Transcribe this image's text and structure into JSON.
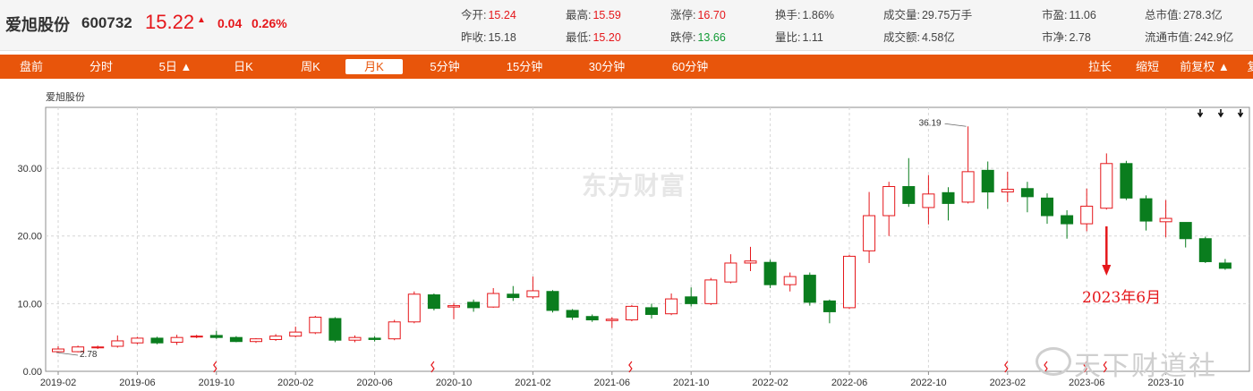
{
  "quote": {
    "name": "爱旭股份",
    "code": "600732",
    "price": "15.22",
    "arrow": "▲",
    "change": "0.04",
    "change_pct": "0.26%",
    "stats": [
      {
        "label": "今开:",
        "value": "15.24",
        "color": "red"
      },
      {
        "label": "昨收:",
        "value": "15.18",
        "color": "dark"
      },
      {
        "label": "最高:",
        "value": "15.59",
        "color": "red"
      },
      {
        "label": "最低:",
        "value": "15.20",
        "color": "red"
      },
      {
        "label": "涨停:",
        "value": "16.70",
        "color": "red"
      },
      {
        "label": "跌停:",
        "value": "13.66",
        "color": "green"
      },
      {
        "label": "换手:",
        "value": "1.86%",
        "color": "dark"
      },
      {
        "label": "量比:",
        "value": "1.11",
        "color": "dark"
      },
      {
        "label": "成交量:",
        "value": "29.75万手",
        "color": "dark"
      },
      {
        "label": "成交额:",
        "value": "4.58亿",
        "color": "dark"
      },
      {
        "label": "市盈:",
        "value": "11.06",
        "color": "dark"
      },
      {
        "label": "市净:",
        "value": "2.78",
        "color": "dark"
      },
      {
        "label": "总市值:",
        "value": "278.3亿",
        "color": "dark"
      },
      {
        "label": "流通市值:",
        "value": "242.9亿",
        "color": "dark"
      }
    ]
  },
  "tabs": {
    "left": [
      "盘前",
      "分时",
      "5日 ▲",
      "日K",
      "周K",
      "月K",
      "5分钟",
      "15分钟",
      "30分钟",
      "60分钟"
    ],
    "right": [
      "拉长",
      "缩短",
      "前复权 ▲",
      "复"
    ],
    "active": "月K"
  },
  "chart_title": "爱旭股份",
  "watermark": "东方财富",
  "watermark2": "天下财道社",
  "annotation": "2023年6月",
  "chart_data": {
    "type": "candlestick",
    "ylim": [
      0,
      39
    ],
    "yticks": [
      "0.00",
      "10.00",
      "20.00",
      "30.00"
    ],
    "xticks": [
      "2019-02",
      "2019-06",
      "2019-10",
      "2020-02",
      "2020-06",
      "2020-10",
      "2021-02",
      "2021-06",
      "2021-10",
      "2022-02",
      "2022-06",
      "2022-10",
      "2023-02",
      "2023-06",
      "2023-10"
    ],
    "grid": true,
    "up_color": "#e5171b",
    "down_color": "#0a7d1e",
    "max_label": "36.19",
    "min_label": "2.78",
    "candles": [
      {
        "o": 2.9,
        "c": 3.3,
        "h": 3.7,
        "l": 2.78
      },
      {
        "o": 2.9,
        "c": 3.6,
        "h": 3.8,
        "l": 2.8
      },
      {
        "o": 3.5,
        "c": 3.6,
        "h": 3.8,
        "l": 3.3
      },
      {
        "o": 3.7,
        "c": 4.5,
        "h": 5.3,
        "l": 3.5
      },
      {
        "o": 4.2,
        "c": 4.9,
        "h": 5.1,
        "l": 4.0
      },
      {
        "o": 4.9,
        "c": 4.2,
        "h": 5.1,
        "l": 4.0
      },
      {
        "o": 4.3,
        "c": 5.0,
        "h": 5.4,
        "l": 3.9
      },
      {
        "o": 5.1,
        "c": 5.2,
        "h": 5.4,
        "l": 4.9
      },
      {
        "o": 5.3,
        "c": 5.0,
        "h": 6.0,
        "l": 4.8
      },
      {
        "o": 5.0,
        "c": 4.4,
        "h": 5.2,
        "l": 4.3
      },
      {
        "o": 4.4,
        "c": 4.8,
        "h": 4.9,
        "l": 4.2
      },
      {
        "o": 4.7,
        "c": 5.2,
        "h": 5.5,
        "l": 4.5
      },
      {
        "o": 5.2,
        "c": 5.8,
        "h": 6.6,
        "l": 5.0
      },
      {
        "o": 5.7,
        "c": 8.0,
        "h": 8.2,
        "l": 5.5
      },
      {
        "o": 7.8,
        "c": 4.6,
        "h": 8.0,
        "l": 4.3
      },
      {
        "o": 4.6,
        "c": 5.0,
        "h": 5.3,
        "l": 4.3
      },
      {
        "o": 4.9,
        "c": 4.7,
        "h": 5.2,
        "l": 4.4
      },
      {
        "o": 4.8,
        "c": 7.3,
        "h": 7.6,
        "l": 4.6
      },
      {
        "o": 7.3,
        "c": 11.4,
        "h": 11.8,
        "l": 7.1
      },
      {
        "o": 11.3,
        "c": 9.3,
        "h": 11.5,
        "l": 9.0
      },
      {
        "o": 9.5,
        "c": 9.7,
        "h": 10.1,
        "l": 7.7
      },
      {
        "o": 10.2,
        "c": 9.4,
        "h": 10.6,
        "l": 8.8
      },
      {
        "o": 9.5,
        "c": 11.5,
        "h": 12.3,
        "l": 9.4
      },
      {
        "o": 11.4,
        "c": 10.9,
        "h": 12.6,
        "l": 10.4
      },
      {
        "o": 11.0,
        "c": 11.9,
        "h": 14.0,
        "l": 10.7
      },
      {
        "o": 11.8,
        "c": 9.0,
        "h": 12.0,
        "l": 8.7
      },
      {
        "o": 9.0,
        "c": 8.0,
        "h": 9.2,
        "l": 7.6
      },
      {
        "o": 8.1,
        "c": 7.6,
        "h": 8.4,
        "l": 7.3
      },
      {
        "o": 7.5,
        "c": 7.7,
        "h": 8.0,
        "l": 6.4
      },
      {
        "o": 7.6,
        "c": 9.6,
        "h": 9.8,
        "l": 7.4
      },
      {
        "o": 9.4,
        "c": 8.4,
        "h": 10.0,
        "l": 7.8
      },
      {
        "o": 8.5,
        "c": 10.7,
        "h": 11.5,
        "l": 8.3
      },
      {
        "o": 11.0,
        "c": 10.0,
        "h": 12.4,
        "l": 9.6
      },
      {
        "o": 10.0,
        "c": 13.5,
        "h": 13.8,
        "l": 9.8
      },
      {
        "o": 13.2,
        "c": 16.0,
        "h": 17.3,
        "l": 13.0
      },
      {
        "o": 16.0,
        "c": 16.3,
        "h": 18.4,
        "l": 14.8
      },
      {
        "o": 16.1,
        "c": 12.8,
        "h": 16.5,
        "l": 12.3
      },
      {
        "o": 12.8,
        "c": 14.0,
        "h": 14.6,
        "l": 11.8
      },
      {
        "o": 14.2,
        "c": 10.2,
        "h": 14.6,
        "l": 9.7
      },
      {
        "o": 10.4,
        "c": 8.8,
        "h": 10.6,
        "l": 7.1
      },
      {
        "o": 9.4,
        "c": 17.0,
        "h": 17.2,
        "l": 9.2
      },
      {
        "o": 17.8,
        "c": 23.0,
        "h": 26.5,
        "l": 16.0
      },
      {
        "o": 23.0,
        "c": 27.3,
        "h": 28.0,
        "l": 20.0
      },
      {
        "o": 27.3,
        "c": 24.8,
        "h": 31.5,
        "l": 24.3
      },
      {
        "o": 24.2,
        "c": 26.2,
        "h": 29.0,
        "l": 21.7
      },
      {
        "o": 26.4,
        "c": 24.8,
        "h": 27.2,
        "l": 22.3
      },
      {
        "o": 25.0,
        "c": 29.5,
        "h": 36.19,
        "l": 24.8
      },
      {
        "o": 29.7,
        "c": 26.5,
        "h": 31.0,
        "l": 24.0
      },
      {
        "o": 26.5,
        "c": 26.9,
        "h": 29.5,
        "l": 25.0
      },
      {
        "o": 27.0,
        "c": 25.8,
        "h": 28.0,
        "l": 23.5
      },
      {
        "o": 25.6,
        "c": 23.0,
        "h": 26.3,
        "l": 21.8
      },
      {
        "o": 23.0,
        "c": 21.8,
        "h": 23.8,
        "l": 19.6
      },
      {
        "o": 21.8,
        "c": 24.4,
        "h": 27.0,
        "l": 20.7
      },
      {
        "o": 24.1,
        "c": 30.7,
        "h": 32.2,
        "l": 23.9
      },
      {
        "o": 30.7,
        "c": 25.6,
        "h": 31.1,
        "l": 25.3
      },
      {
        "o": 25.5,
        "c": 22.2,
        "h": 26.0,
        "l": 20.8
      },
      {
        "o": 22.1,
        "c": 22.6,
        "h": 25.3,
        "l": 19.8
      },
      {
        "o": 22.0,
        "c": 19.6,
        "h": 22.0,
        "l": 18.3
      },
      {
        "o": 19.6,
        "c": 16.2,
        "h": 19.9,
        "l": 16.0
      },
      {
        "o": 16.0,
        "c": 15.22,
        "h": 16.6,
        "l": 15.0
      }
    ]
  }
}
